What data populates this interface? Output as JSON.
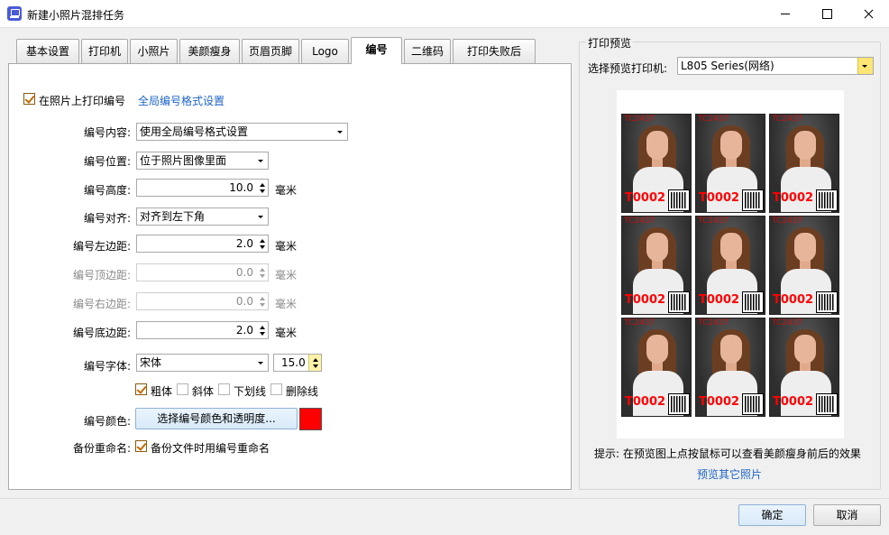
{
  "window": {
    "title": "新建小照片混排任务"
  },
  "tabs": [
    {
      "label": "基本设置"
    },
    {
      "label": "打印机"
    },
    {
      "label": "小照片"
    },
    {
      "label": "美颜瘦身"
    },
    {
      "label": "页眉页脚"
    },
    {
      "label": "Logo"
    },
    {
      "label": "编号",
      "active": true
    },
    {
      "label": "二维码"
    },
    {
      "label": "打印失败后"
    }
  ],
  "numbering": {
    "print_on_photo_label": "在照片上打印编号",
    "print_on_photo_checked": true,
    "global_format_link": "全局编号格式设置",
    "content_label": "编号内容:",
    "content_value": "使用全局编号格式设置",
    "position_label": "编号位置:",
    "position_value": "位于照片图像里面",
    "height_label": "编号高度:",
    "height_value": "10.0",
    "align_label": "编号对齐:",
    "align_value": "对齐到左下角",
    "left_margin_label": "编号左边距:",
    "left_margin_value": "2.0",
    "top_margin_label": "编号顶边距:",
    "top_margin_value": "0.0",
    "right_margin_label": "编号右边距:",
    "right_margin_value": "0.0",
    "bottom_margin_label": "编号底边距:",
    "bottom_margin_value": "2.0",
    "unit": "毫米",
    "font_label": "编号字体:",
    "font_value": "宋体",
    "font_size_value": "15.0",
    "bold_label": "粗体",
    "bold_checked": true,
    "italic_label": "斜体",
    "underline_label": "下划线",
    "strike_label": "删除线",
    "color_label": "编号颜色:",
    "color_button": "选择编号颜色和透明度...",
    "color_value": "#ff0000",
    "backup_label": "备份重命名:",
    "backup_checkbox_label": "备份文件时用编号重命名",
    "backup_checked": true
  },
  "preview": {
    "group_title": "打印预览",
    "printer_label": "选择预览打印机:",
    "printer_value": "L805 Series(网络)",
    "photo_number": "T0002",
    "photo_tag": "TC2437",
    "hint": "提示: 在预览图上点按鼠标可以查看美颜瘦身前后的效果",
    "other_photos_link": "预览其它照片"
  },
  "footer": {
    "ok_label": "确定",
    "cancel_label": "取消"
  }
}
